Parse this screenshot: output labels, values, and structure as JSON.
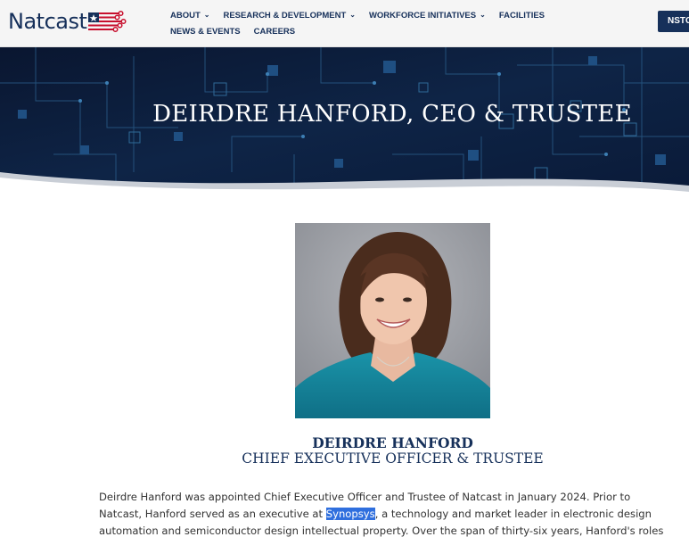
{
  "header": {
    "logo_text": "Natcast",
    "nav_row1": [
      {
        "label": "ABOUT",
        "has_dropdown": true
      },
      {
        "label": "RESEARCH & DEVELOPMENT",
        "has_dropdown": true
      },
      {
        "label": "WORKFORCE INITIATIVES",
        "has_dropdown": true
      },
      {
        "label": "FACILITIES",
        "has_dropdown": false
      }
    ],
    "nav_row2": [
      {
        "label": "NEWS & EVENTS",
        "has_dropdown": false
      },
      {
        "label": "CAREERS",
        "has_dropdown": false
      }
    ],
    "cta_label": "NSTC"
  },
  "hero": {
    "title": "DEIRDRE HANFORD, CEO & TRUSTEE"
  },
  "profile": {
    "name": "DEIRDRE HANFORD",
    "role": "CHIEF EXECUTIVE OFFICER & TRUSTEE"
  },
  "bio": {
    "line1": "Deirdre Hanford was appointed Chief Executive Officer and Trustee of Natcast in January 2024.  Prior to",
    "line2_before": "Natcast, Hanford served as an executive at ",
    "line2_link": "Synopsys",
    "line2_after": ", a technology and market leader in electronic design",
    "line3": "automation and semiconductor design intellectual property.  Over the span of thirty-six years, Hanford's roles"
  },
  "colors": {
    "brand_navy": "#16305a",
    "brand_red": "#c8102e",
    "hero_bg": "#0b1a33",
    "selection": "#2f6fde"
  }
}
